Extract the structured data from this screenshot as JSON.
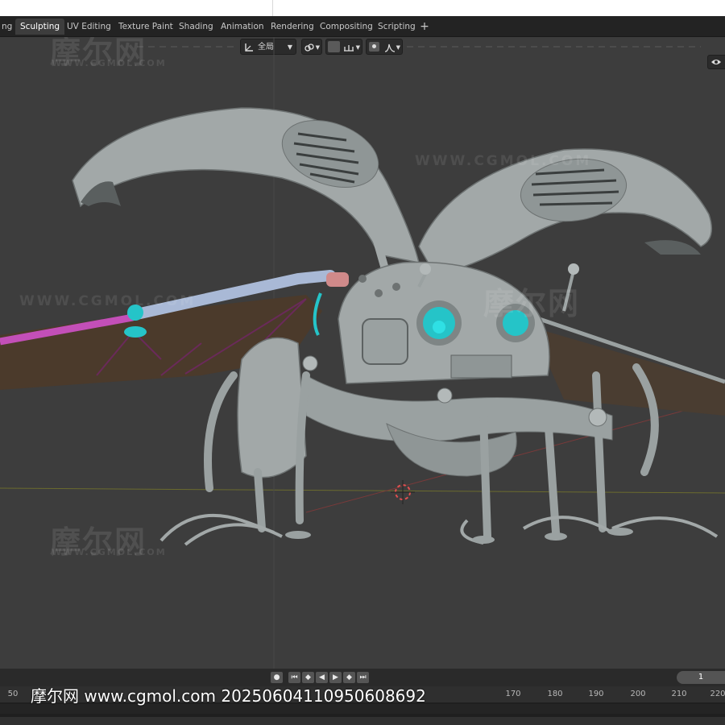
{
  "workspace_tabs": [
    {
      "label": "ng",
      "active": false
    },
    {
      "label": "Sculpting",
      "active": true
    },
    {
      "label": "UV Editing",
      "active": false
    },
    {
      "label": "Texture Paint",
      "active": false
    },
    {
      "label": "Shading",
      "active": false
    },
    {
      "label": "Animation",
      "active": false
    },
    {
      "label": "Rendering",
      "active": false
    },
    {
      "label": "Compositing",
      "active": false
    },
    {
      "label": "Scripting",
      "active": false
    }
  ],
  "add_tab_label": "+",
  "viewport_header": {
    "orientation_label": "全局",
    "transform_icon": "orientation-axes-icon",
    "pivot_icon": "pivot-link-icon",
    "snap_icon": "magnet-snap-icon",
    "snap_target_icon": "snap-increment-icon",
    "proportional_icon": "proportional-edit-icon",
    "falloff_icon": "falloff-curve-icon",
    "visibility_icon": "eye-icon"
  },
  "watermarks": {
    "logo_text": "摩尔网",
    "url_small": "WWW.CGMOL.COM",
    "url_large": "WWW.CGMOL.COM"
  },
  "timeline": {
    "current_frame": "1",
    "ruler_ticks": [
      "50",
      "170",
      "180",
      "190",
      "200",
      "210",
      "220"
    ],
    "controls": [
      "record-icon",
      "jump-start-icon",
      "prev-keyframe-icon",
      "play-reverse-icon",
      "play-icon",
      "next-keyframe-icon",
      "jump-end-icon"
    ]
  },
  "overlay_caption": "摩尔网 www.cgmol.com 20250604110950608692",
  "colors": {
    "viewport_bg": "#3d3d3d",
    "mesh_gray": "#9aa1a1",
    "accent_cyan": "#25c4c8",
    "tube_blue": "#a9b9d6",
    "tube_pink": "#c34fb8",
    "wing_membrane": "#4a3a2c"
  }
}
